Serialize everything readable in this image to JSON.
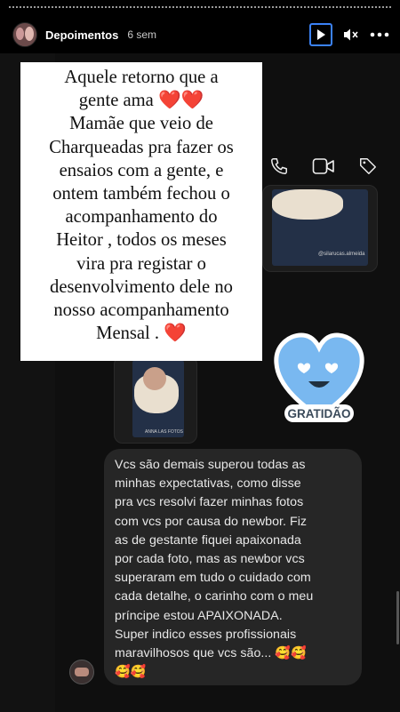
{
  "header": {
    "username": "Depoimentos",
    "time_ago": "6 sem"
  },
  "icons": {
    "play": "play-icon",
    "mute": "mute-icon",
    "more": "more-options-icon",
    "phone": "phone-icon",
    "video": "video-camera-icon",
    "tag": "tag-icon"
  },
  "caption": {
    "lines": [
      "Aquele retorno que a",
      "gente ama ❤️❤️",
      "Mamãe que veio de",
      "Charqueadas pra fazer os",
      "ensaios com a gente, e",
      "ontem também fechou o",
      "acompanhamento do",
      "Heitor , todos os meses",
      "vira pra registar o",
      "desenvolvimento dele no",
      "nosso acompanhamento",
      "Mensal . ❤️"
    ]
  },
  "thumbnails": {
    "top_watermark": "@silarucas.almeida",
    "bottom_watermark": "ANNA LAS FOTOS"
  },
  "sticker": {
    "label": "GRATIDÃO"
  },
  "message": {
    "lines": [
      "Vcs são demais superou todas as",
      "minhas expectativas, como disse",
      "pra vcs resolvi fazer minhas fotos",
      "com vcs por causa do newbor. Fiz",
      "as de gestante fiquei apaixonada",
      "por cada foto, mas as newbor vcs",
      "superaram em tudo o cuidado com",
      "cada detalhe, o carinho com o meu",
      "príncipe estou APAIXONADA.",
      "Super indico esses profissionais",
      "maravilhosos que vcs são... 🥰🥰",
      "🥰🥰"
    ]
  },
  "colors": {
    "accent": "#3b82f6",
    "heart_fill": "#79b8f0",
    "bubble": "#262626"
  }
}
